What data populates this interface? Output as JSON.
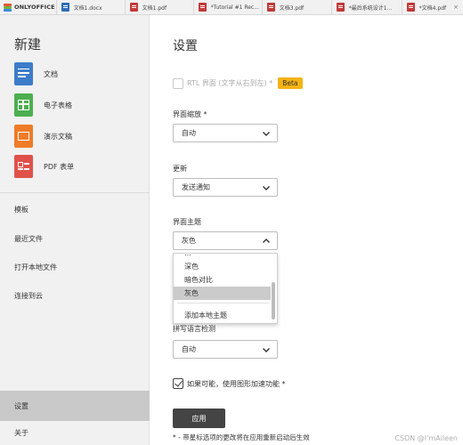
{
  "app": {
    "brand": "ONLYOFFICE"
  },
  "tabs": [
    {
      "label": "文档1.docx",
      "type": "doc",
      "close": "×"
    },
    {
      "label": "文档1.pdf",
      "type": "pdf",
      "close": "×"
    },
    {
      "label": "*Tutorial #1 Rec...",
      "type": "pdf",
      "close": "×"
    },
    {
      "label": "文档3.pdf",
      "type": "pdf",
      "close": "×"
    },
    {
      "label": "*最后系统设计1...",
      "type": "pdf",
      "close": "×"
    },
    {
      "label": "*文档4.pdf",
      "type": "pdf",
      "close": "×"
    }
  ],
  "sidebar": {
    "create_title": "新建",
    "create_items": [
      {
        "label": "文档",
        "icon": "document-icon",
        "color": "#3d7cc9"
      },
      {
        "label": "电子表格",
        "icon": "spreadsheet-icon",
        "color": "#4caf50"
      },
      {
        "label": "演示文稿",
        "icon": "presentation-icon",
        "color": "#ef7c28"
      },
      {
        "label": "PDF 表单",
        "icon": "pdf-form-icon",
        "color": "#e0514a"
      }
    ],
    "nav_items": [
      {
        "label": "模板"
      },
      {
        "label": "最近文件"
      },
      {
        "label": "打开本地文件"
      },
      {
        "label": "连接到云"
      }
    ],
    "bottom_items": [
      {
        "label": "设置",
        "active": true
      },
      {
        "label": "关于",
        "active": false
      }
    ]
  },
  "settings": {
    "title": "设置",
    "rtl": {
      "label": "RTL 界面 (文字从右到左) *",
      "checked": false,
      "disabled": true,
      "badge": "Beta"
    },
    "scale": {
      "label": "界面缩放 *",
      "value": "自动"
    },
    "update": {
      "label": "更新",
      "value": "发送通知"
    },
    "theme": {
      "label": "界面主题",
      "value": "灰色",
      "options_cut": "…",
      "options": [
        "深色",
        "暗色对比",
        "灰色"
      ],
      "selected_option": "灰色",
      "add_local_theme": "添加本地主题"
    },
    "spellcheck": {
      "label": "拼写语言检测",
      "value": "自动"
    },
    "hw_accel": {
      "label": "如果可能，使用图形加速功能 *",
      "checked": true
    },
    "apply_label": "应用",
    "note": "* - 带星标选项的更改将在应用重新启动后生效"
  },
  "watermark": "CSDN @I'mAileen",
  "colors": {
    "accent_badge": "#f5b315",
    "apply_button": "#444444",
    "active_nav": "#c9c9c9"
  }
}
